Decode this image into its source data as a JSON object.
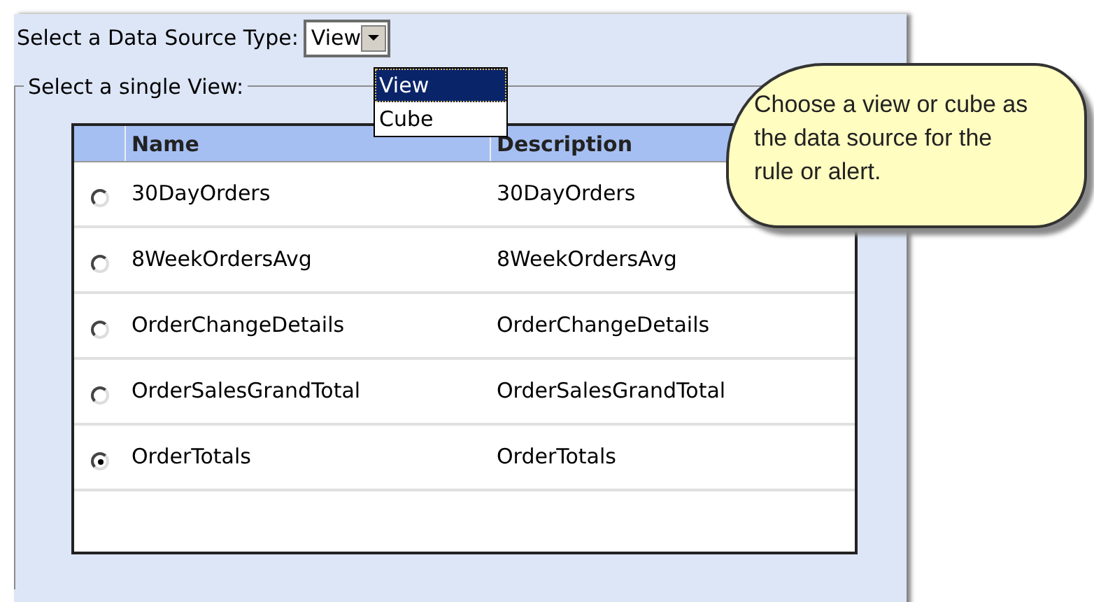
{
  "data_source": {
    "label": "Select a Data Source Type:",
    "value": "View",
    "expanded": true,
    "options": [
      {
        "label": "View",
        "selected": true
      },
      {
        "label": "Cube",
        "selected": false
      }
    ]
  },
  "group": {
    "legend": "Select a single View:"
  },
  "table": {
    "columns": [
      "Name",
      "Description"
    ],
    "rows": [
      {
        "name": "30DayOrders",
        "description": "30DayOrders",
        "selected": false
      },
      {
        "name": "8WeekOrdersAvg",
        "description": "8WeekOrdersAvg",
        "selected": false
      },
      {
        "name": "OrderChangeDetails",
        "description": "OrderChangeDetails",
        "selected": false
      },
      {
        "name": "OrderSalesGrandTotal",
        "description": "OrderSalesGrandTotal",
        "selected": false
      },
      {
        "name": "OrderTotals",
        "description": "OrderTotals",
        "selected": true
      }
    ]
  },
  "callout": {
    "text": "Choose a view or cube as the data source for the rule or alert."
  }
}
